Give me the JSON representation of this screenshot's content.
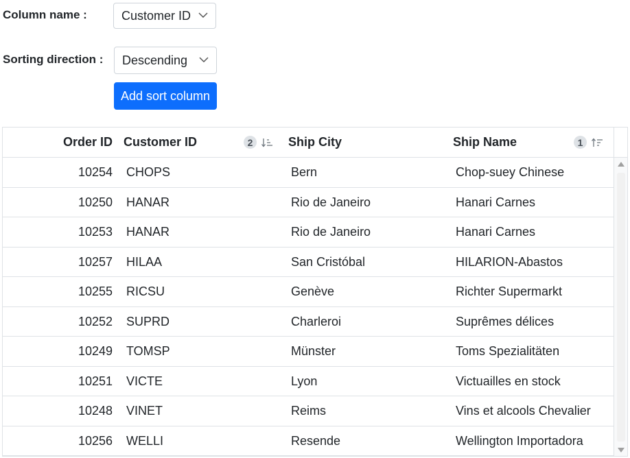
{
  "form": {
    "column_label": "Column name :",
    "column_value": "Customer ID",
    "direction_label": "Sorting direction :",
    "direction_value": "Descending",
    "add_button": "Add sort column"
  },
  "grid": {
    "headers": [
      {
        "label": "Order ID"
      },
      {
        "label": "Customer ID",
        "sort_order": "2",
        "sort_direction": "descending"
      },
      {
        "label": "Ship City"
      },
      {
        "label": "Ship Name",
        "sort_order": "1",
        "sort_direction": "ascending"
      }
    ],
    "rows": [
      {
        "order_id": "10254",
        "customer_id": "CHOPS",
        "ship_city": "Bern",
        "ship_name": "Chop-suey Chinese"
      },
      {
        "order_id": "10250",
        "customer_id": "HANAR",
        "ship_city": "Rio de Janeiro",
        "ship_name": "Hanari Carnes"
      },
      {
        "order_id": "10253",
        "customer_id": "HANAR",
        "ship_city": "Rio de Janeiro",
        "ship_name": "Hanari Carnes"
      },
      {
        "order_id": "10257",
        "customer_id": "HILAA",
        "ship_city": "San Cristóbal",
        "ship_name": "HILARION-Abastos"
      },
      {
        "order_id": "10255",
        "customer_id": "RICSU",
        "ship_city": "Genève",
        "ship_name": "Richter Supermarkt"
      },
      {
        "order_id": "10252",
        "customer_id": "SUPRD",
        "ship_city": "Charleroi",
        "ship_name": "Suprêmes délices"
      },
      {
        "order_id": "10249",
        "customer_id": "TOMSP",
        "ship_city": "Münster",
        "ship_name": "Toms Spezialitäten"
      },
      {
        "order_id": "10251",
        "customer_id": "VICTE",
        "ship_city": "Lyon",
        "ship_name": "Victuailles en stock"
      },
      {
        "order_id": "10248",
        "customer_id": "VINET",
        "ship_city": "Reims",
        "ship_name": "Vins et alcools Chevalier"
      },
      {
        "order_id": "10256",
        "customer_id": "WELLI",
        "ship_city": "Resende",
        "ship_name": "Wellington Importadora"
      }
    ]
  },
  "colors": {
    "primary": "#0d6efd",
    "border": "#dee2e6",
    "badge_bg": "#dee2e6"
  },
  "icons": {
    "select_arrow": "chevron-down-icon",
    "sort_desc": "sort-descending-icon",
    "sort_asc": "sort-ascending-icon"
  }
}
